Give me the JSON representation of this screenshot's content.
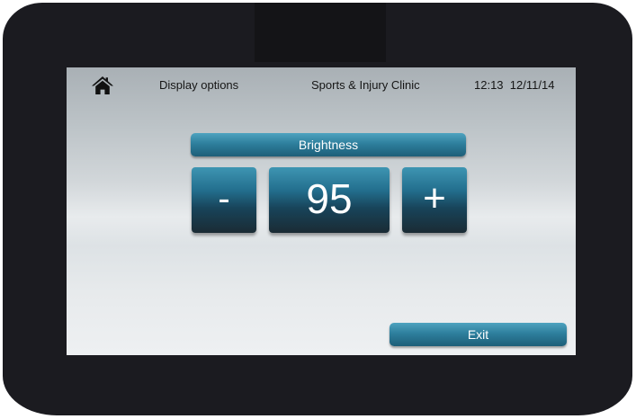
{
  "header": {
    "home_icon": "home-icon",
    "section_title": "Display options",
    "clinic_name": "Sports & Injury Clinic",
    "time": "12:13",
    "date": "12/11/14"
  },
  "brightness": {
    "label": "Brightness",
    "decrease_label": "-",
    "value": "95",
    "increase_label": "+"
  },
  "footer": {
    "exit_label": "Exit"
  },
  "colors": {
    "bezel": "#1b1b20",
    "button_top": "#3e95b2",
    "button_bottom": "#1a2b34"
  }
}
